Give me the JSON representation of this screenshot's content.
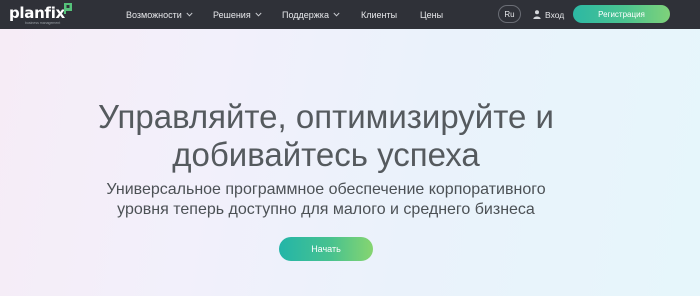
{
  "header": {
    "logo": {
      "text": "planfix",
      "tagline": "business management"
    },
    "nav": [
      {
        "label": "Возможности",
        "has_dropdown": true
      },
      {
        "label": "Решения",
        "has_dropdown": true
      },
      {
        "label": "Поддержка",
        "has_dropdown": true
      },
      {
        "label": "Клиенты",
        "has_dropdown": false
      },
      {
        "label": "Цены",
        "has_dropdown": false
      }
    ],
    "language": "Ru",
    "login_label": "Вход",
    "register_label": "Регистрация"
  },
  "hero": {
    "title_line1": "Управляйте, оптимизируйте и",
    "title_line2": "добивайтесь успеха",
    "subtitle_line1": "Универсальное программное обеспечение корпоративного",
    "subtitle_line2": "уровня теперь доступно для малого и среднего бизнеса",
    "cta_label": "Начать"
  },
  "colors": {
    "header_bg": "#2f3138",
    "accent_gradient_start": "#2cb8a4",
    "accent_gradient_end": "#7fd27a",
    "title_text": "#555a5e"
  },
  "icons": {
    "logo_flag": "flag-icon",
    "dropdown": "chevron-down-icon",
    "login": "user-icon"
  }
}
